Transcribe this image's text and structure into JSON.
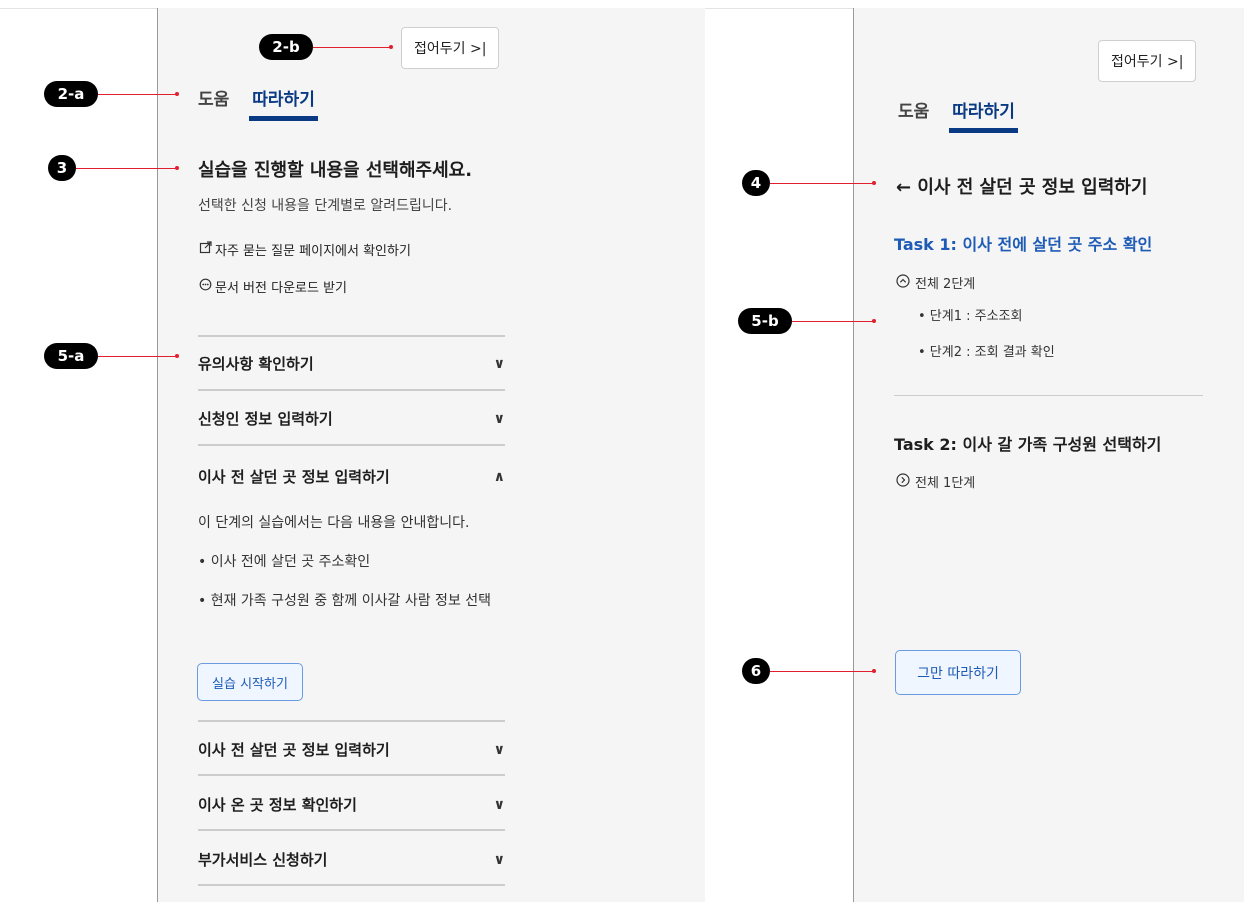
{
  "left_panel": {
    "collapse_label": "접어두기 >|",
    "tabs": [
      "도움",
      "따라하기"
    ],
    "heading": "실습을 진행할 내용을 선택해주세요.",
    "subtext": "선택한 신청 내용을 단계별로 알려드립니다.",
    "links": [
      "자주 묻는 질문 페이지에서 확인하기",
      "문서 버전 다운로드 받기"
    ],
    "accordion": [
      {
        "title": "유의사항 확인하기",
        "chevron": "∨"
      },
      {
        "title": "신청인 정보 입력하기",
        "chevron": "∨"
      },
      {
        "title": "이사 전 살던 곳 정보 입력하기",
        "chevron": "∧"
      },
      {
        "title": "이사 전 살던 곳 정보 입력하기",
        "chevron": "∨"
      },
      {
        "title": "이사 온 곳 정보 확인하기",
        "chevron": "∨"
      },
      {
        "title": "부가서비스 신청하기",
        "chevron": "∨"
      }
    ],
    "expanded": {
      "intro": "이 단계의 실습에서는 다음 내용을 안내합니다.",
      "bullets": [
        "• 이사 전에 살던 곳 주소확인",
        "• 현재 가족 구성원 중 함께 이사갈 사람 정보 선택"
      ],
      "start_button": "실습 시작하기"
    }
  },
  "right_panel": {
    "collapse_label": "접어두기 >|",
    "tabs": [
      "도움",
      "따라하기"
    ],
    "back_heading": "← 이사 전 살던 곳 정보 입력하기",
    "task1": {
      "title": "Task 1: 이사 전에 살던 곳 주소 확인",
      "summary": "전체 2단계",
      "steps": [
        "• 단계1 : 주소조회",
        "• 단계2 : 조회 결과 확인"
      ]
    },
    "task2": {
      "title": "Task 2: 이사 갈 가족 구성원 선택하기",
      "summary": "전체 1단계"
    },
    "stop_button": "그만 따라하기"
  },
  "annotations": [
    "2-b",
    "2-a",
    "3",
    "5-a",
    "4",
    "5-b",
    "6"
  ],
  "colors": {
    "accent": "#0b3a84",
    "task_blue": "#1d5bb6",
    "callout": "#e0202f"
  }
}
